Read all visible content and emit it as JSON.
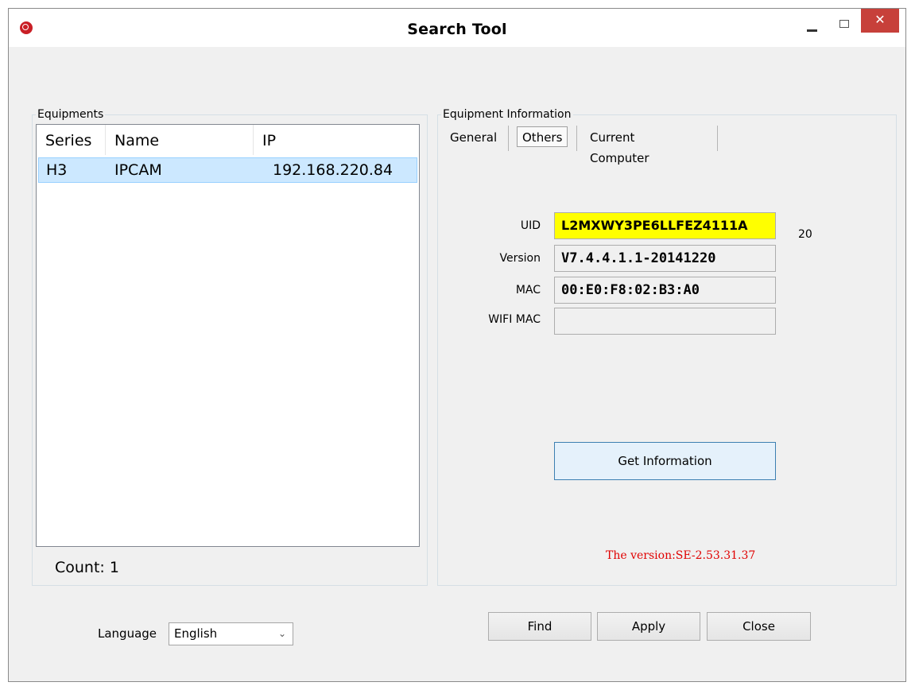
{
  "window": {
    "title": "Search Tool",
    "close_glyph": "✕"
  },
  "equipments": {
    "group_title": "Equipments",
    "columns": [
      "Series",
      "Name",
      "IP"
    ],
    "rows": [
      {
        "series": "H3",
        "name": "IPCAM",
        "ip": "192.168.220.84"
      }
    ],
    "count_label": "Count: 1"
  },
  "info": {
    "group_title": "Equipment Information",
    "tabs": [
      "General",
      "Others",
      "Current Computer"
    ],
    "active_tab": "Others",
    "uid_label": "UID",
    "uid_value": "L2MXWY3PE6LLFEZ4111A",
    "uid_length": "20",
    "version_label": "Version",
    "version_value": "V7.4.4.1.1-20141220",
    "mac_label": "MAC",
    "mac_value": "00:E0:F8:02:B3:A0",
    "wifi_mac_label": "WIFI MAC",
    "wifi_mac_value": "",
    "get_info_label": "Get Information",
    "version_note": "The version:SE-2.53.31.37"
  },
  "footer": {
    "language_label": "Language",
    "language_value": "English",
    "find_label": "Find",
    "apply_label": "Apply",
    "close_label": "Close"
  },
  "colors": {
    "uid_highlight": "#ffff00",
    "selected_row": "#cce8ff",
    "version_note": "#e00000",
    "close_button": "#c7403a"
  }
}
